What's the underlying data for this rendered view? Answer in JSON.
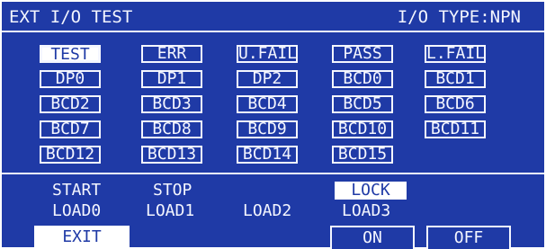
{
  "header": {
    "title": "EXT I/O TEST",
    "io_type": "I/O TYPE:NPN"
  },
  "grid": {
    "rows": [
      [
        "TEST",
        "ERR",
        "U.FAIL",
        "PASS",
        "L.FAIL"
      ],
      [
        "DP0",
        "DP1",
        "DP2",
        "BCD0",
        "BCD1"
      ],
      [
        "BCD2",
        "BCD3",
        "BCD4",
        "BCD5",
        "BCD6"
      ],
      [
        "BCD7",
        "BCD8",
        "BCD9",
        "BCD10",
        "BCD11"
      ],
      [
        "BCD12",
        "BCD13",
        "BCD14",
        "BCD15"
      ]
    ],
    "selected": "TEST"
  },
  "inputs": {
    "row1": [
      "START",
      "STOP",
      "",
      "LOCK"
    ],
    "row2": [
      "LOAD0",
      "LOAD1",
      "LOAD2",
      "LOAD3"
    ],
    "highlighted": "LOCK"
  },
  "buttons": {
    "exit": "EXIT",
    "on": "ON",
    "off": "OFF"
  },
  "colors": {
    "background": "#1f3aa6",
    "foreground": "#f4f6ff"
  }
}
